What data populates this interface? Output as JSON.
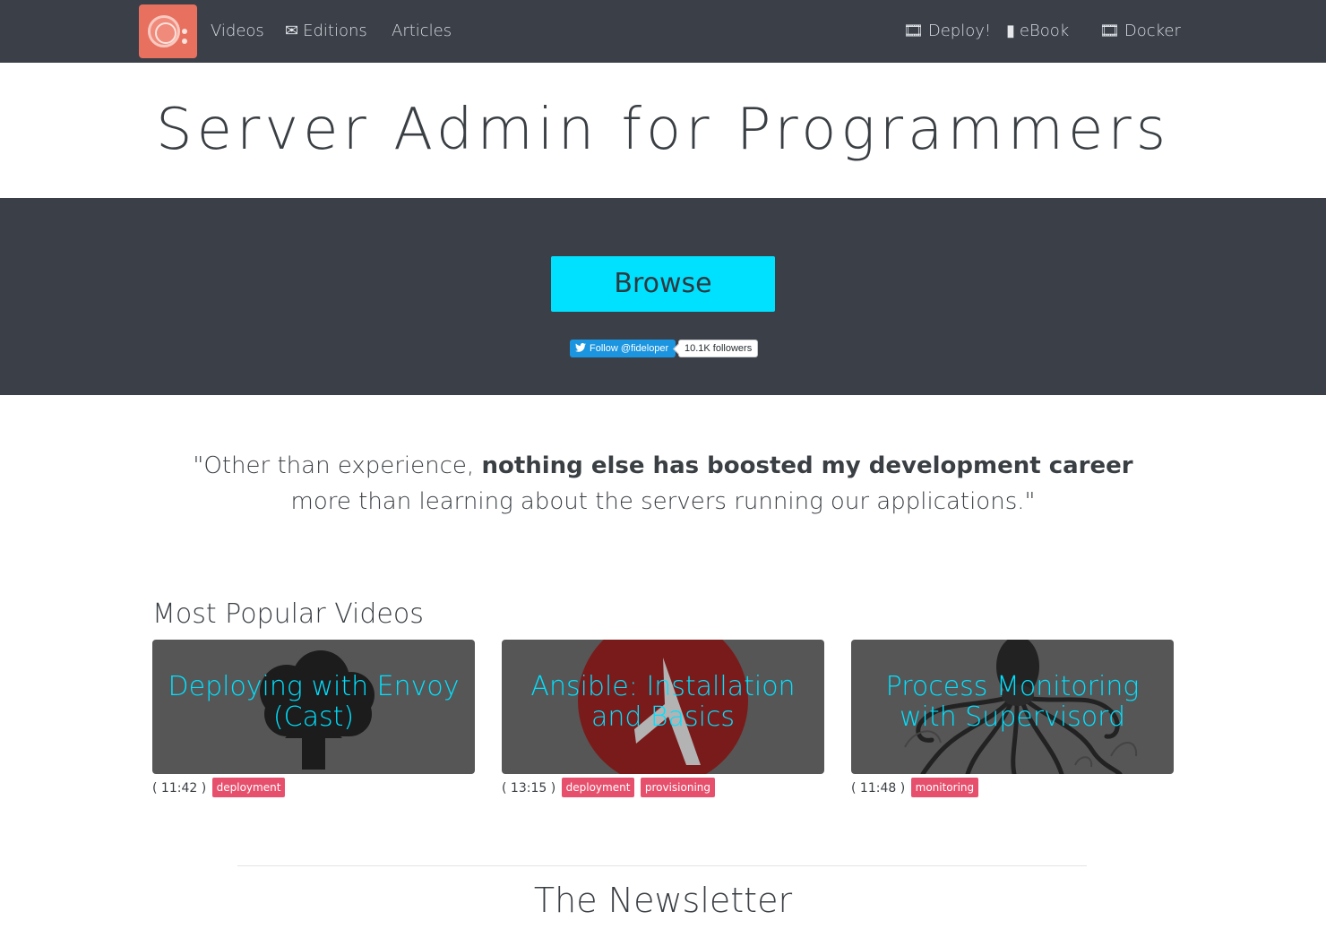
{
  "nav": {
    "left": [
      {
        "label": "Videos",
        "icon": ""
      },
      {
        "label": "Editions",
        "icon": "envelope-icon"
      },
      {
        "label": "Articles",
        "icon": ""
      }
    ],
    "right": [
      {
        "label": "Deploy!",
        "icon": "film-icon"
      },
      {
        "label": "eBook",
        "icon": "book-icon"
      },
      {
        "label": "Docker",
        "icon": "film-icon"
      }
    ]
  },
  "site": {
    "title": "Server Admin for Programmers"
  },
  "hero": {
    "browse_label": "Browse",
    "twitter_follow_label": "Follow @fideloper",
    "twitter_followers": "10.1K followers"
  },
  "quote": {
    "part1": "\"Other than experience, ",
    "bold": "nothing else has boosted my development career",
    "part2": "more than learning about the servers running our applications.\""
  },
  "popular": {
    "heading": "Most Popular Videos",
    "videos": [
      {
        "title": "Deploying with Envoy (Cast)",
        "duration": "( 11:42 )",
        "tags": [
          "deployment"
        ],
        "image": "cloud-upload-icon"
      },
      {
        "title": "Ansible: Installation and Basics",
        "duration": "( 13:15 )",
        "tags": [
          "deployment",
          "provisioning"
        ],
        "image": "ansible-logo"
      },
      {
        "title": "Process Monitoring with Supervisord",
        "duration": "( 11:48 )",
        "tags": [
          "monitoring"
        ],
        "image": "octopus-illustration"
      }
    ]
  },
  "newsletter": {
    "heading": "The Newsletter"
  },
  "colors": {
    "navbar": "#3a3f48",
    "accent": "#00e1ff",
    "tag": "#e7506d",
    "logo": "#e8705f"
  }
}
